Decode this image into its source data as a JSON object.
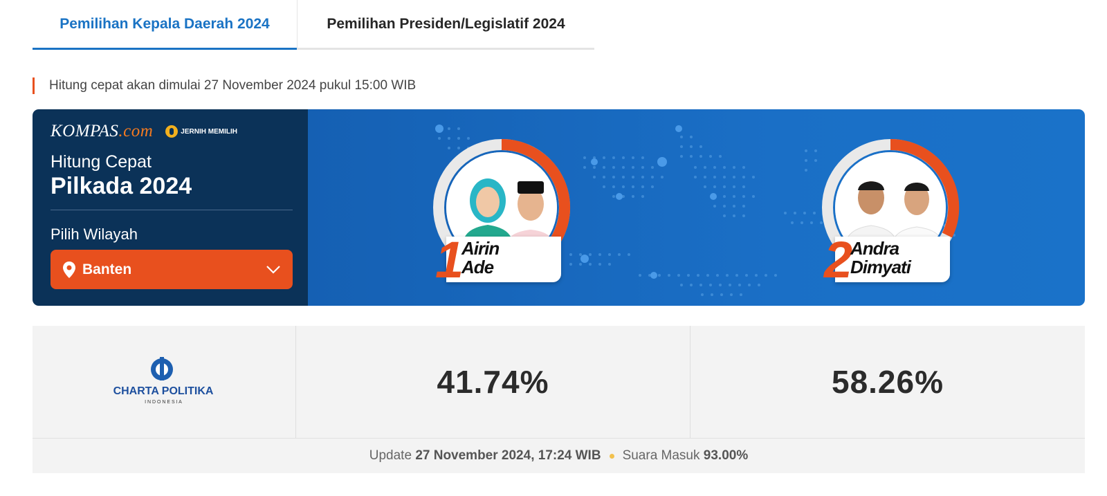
{
  "tabs": [
    {
      "label": "Pemilihan Kepala Daerah 2024",
      "active": true
    },
    {
      "label": "Pemilihan Presiden/Legislatif 2024",
      "active": false
    }
  ],
  "notice": "Hitung cepat akan dimulai 27 November 2024 pukul 15:00 WIB",
  "banner": {
    "brand": {
      "name": "KOMPAS",
      "suffix": ".com",
      "badge": "JERNIH MEMILIH"
    },
    "title": "Hitung Cepat",
    "subtitle": "Pilkada 2024",
    "region_label": "Pilih Wilayah",
    "region_value": "Banten",
    "candidates": [
      {
        "number": "1",
        "name_line1": "Airin",
        "name_line2": "Ade"
      },
      {
        "number": "2",
        "name_line1": "Andra",
        "name_line2": "Dimyati"
      }
    ]
  },
  "results": {
    "pollster": {
      "name": "CHARTA POLITIKA",
      "tagline": "I N D O N E S I A"
    },
    "values": [
      "41.74%",
      "58.26%"
    ]
  },
  "footer": {
    "update_label": "Update",
    "update_value": "27 November 2024, 17:24 WIB",
    "votes_label": "Suara Masuk",
    "votes_value": "93.00%"
  },
  "colors": {
    "accent_blue": "#1a73c4",
    "accent_orange": "#e8501e",
    "panel_navy": "#0b3258",
    "banner_blue": "#1565c0"
  }
}
